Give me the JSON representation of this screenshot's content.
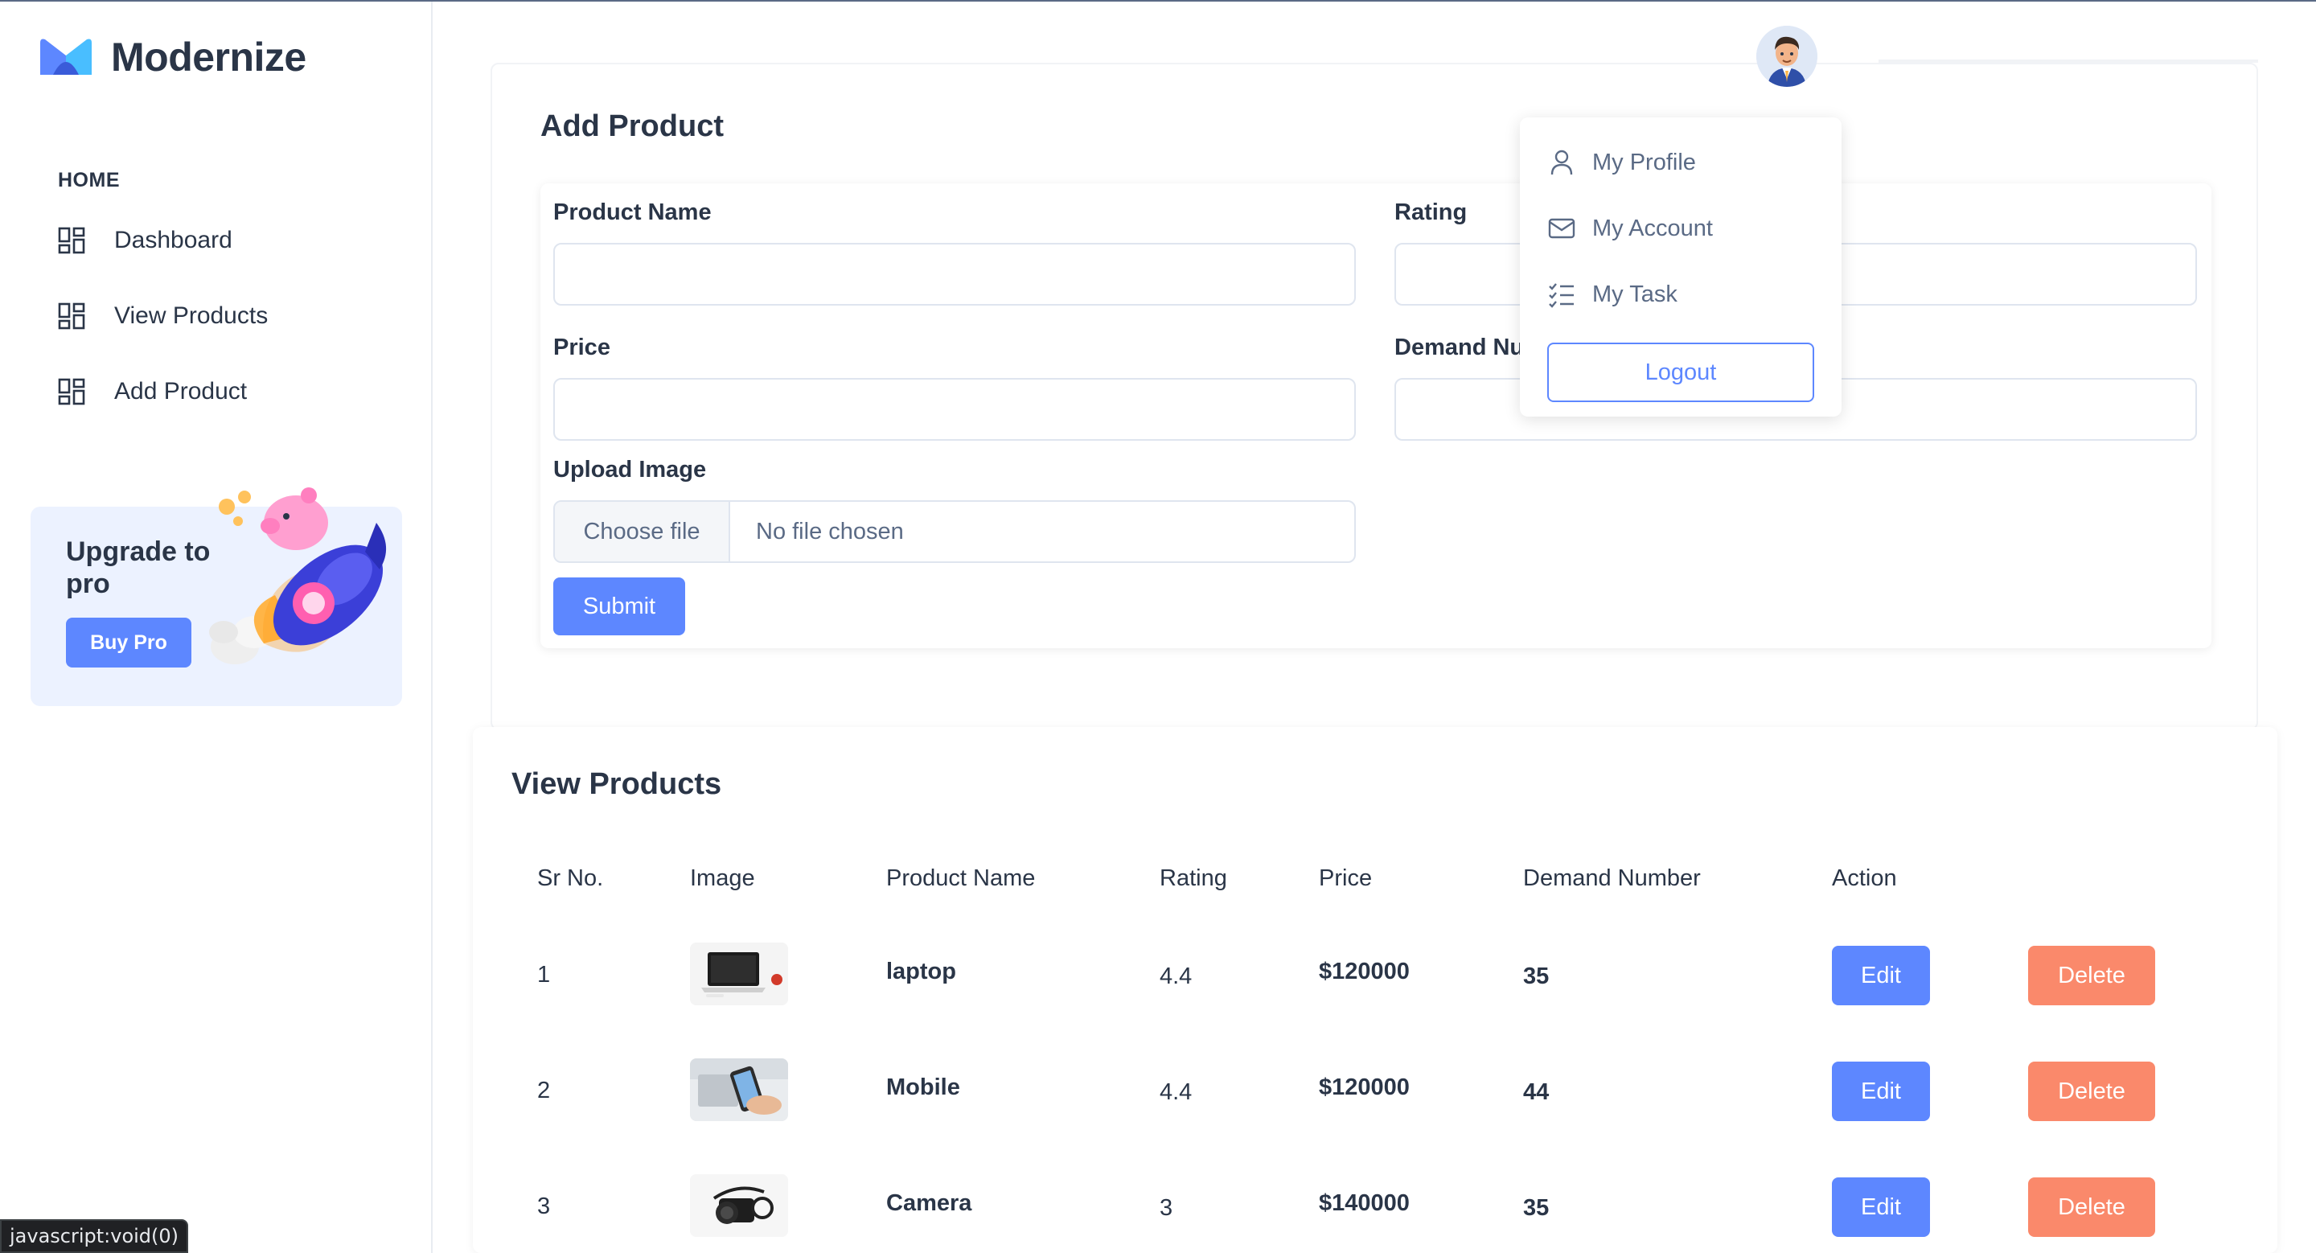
{
  "brand": {
    "name": "Modernize"
  },
  "sidebar": {
    "section_caption": "HOME",
    "items": [
      {
        "label": "Dashboard",
        "icon": "layout-dashboard-icon"
      },
      {
        "label": "View Products",
        "icon": "layout-dashboard-icon"
      },
      {
        "label": "Add Product",
        "icon": "layout-dashboard-icon"
      }
    ],
    "upgrade": {
      "title": "Upgrade to pro",
      "button": "Buy Pro"
    }
  },
  "add_product": {
    "title": "Add Product",
    "fields": {
      "product_name": {
        "label": "Product Name",
        "value": ""
      },
      "rating": {
        "label": "Rating",
        "value": ""
      },
      "price": {
        "label": "Price",
        "value": ""
      },
      "demand_number": {
        "label": "Demand Nu",
        "value": ""
      },
      "upload_image": {
        "label": "Upload Image",
        "button": "Choose file",
        "status": "No file chosen"
      }
    },
    "submit": "Submit"
  },
  "profile_menu": {
    "items": [
      {
        "label": "My Profile",
        "icon": "user-icon"
      },
      {
        "label": "My Account",
        "icon": "mail-icon"
      },
      {
        "label": "My Task",
        "icon": "list-check-icon"
      }
    ],
    "logout": "Logout"
  },
  "view_products": {
    "title": "View Products",
    "columns": [
      "Sr No.",
      "Image",
      "Product Name",
      "Rating",
      "Price",
      "Demand Number",
      "Action"
    ],
    "rows": [
      {
        "sr": "1",
        "image": "laptop-photo",
        "name": "laptop",
        "rating": "4.4",
        "price": "$120000",
        "demand": "35",
        "edit": "Edit",
        "delete": "Delete"
      },
      {
        "sr": "2",
        "image": "mobile-photo",
        "name": "Mobile",
        "rating": "4.4",
        "price": "$120000",
        "demand": "44",
        "edit": "Edit",
        "delete": "Delete"
      },
      {
        "sr": "3",
        "image": "camera-photo",
        "name": "Camera",
        "rating": "3",
        "price": "$140000",
        "demand": "35",
        "edit": "Edit",
        "delete": "Delete"
      }
    ]
  },
  "status_bar": {
    "text": "javascript:void(0)"
  },
  "colors": {
    "primary": "#5d87ff",
    "danger": "#fa896b",
    "text": "#2a3547",
    "muted": "#5a6a85",
    "light_primary": "#ecf2ff"
  }
}
